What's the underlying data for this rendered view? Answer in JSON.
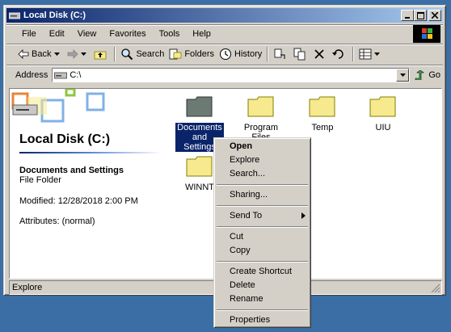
{
  "window": {
    "title": "Local Disk (C:)"
  },
  "menu": [
    "File",
    "Edit",
    "View",
    "Favorites",
    "Tools",
    "Help"
  ],
  "toolbar": {
    "back": "Back",
    "search": "Search",
    "folders": "Folders",
    "history": "History"
  },
  "address": {
    "label": "Address",
    "value": "C:\\",
    "go": "Go"
  },
  "left_pane": {
    "drive_title": "Local Disk (C:)",
    "selected_name": "Documents and Settings",
    "selected_type": "File Folder",
    "modified": "Modified: 12/28/2018 2:00 PM",
    "attributes": "Attributes: (normal)"
  },
  "folders": [
    {
      "label": "Documents and Settings"
    },
    {
      "label": "Program Files"
    },
    {
      "label": "Temp"
    },
    {
      "label": "UIU"
    },
    {
      "label": "WINNT"
    }
  ],
  "status": {
    "text": "Explore"
  },
  "context_menu": {
    "open": "Open",
    "explore": "Explore",
    "search": "Search...",
    "sharing": "Sharing...",
    "send_to": "Send To",
    "cut": "Cut",
    "copy": "Copy",
    "create_shortcut": "Create Shortcut",
    "delete": "Delete",
    "rename": "Rename",
    "properties": "Properties"
  },
  "colors": {
    "desktop": "#3a6ea5",
    "titlebar": "#0a246a",
    "selection": "#0a246a",
    "folder": "#f7e98e"
  }
}
